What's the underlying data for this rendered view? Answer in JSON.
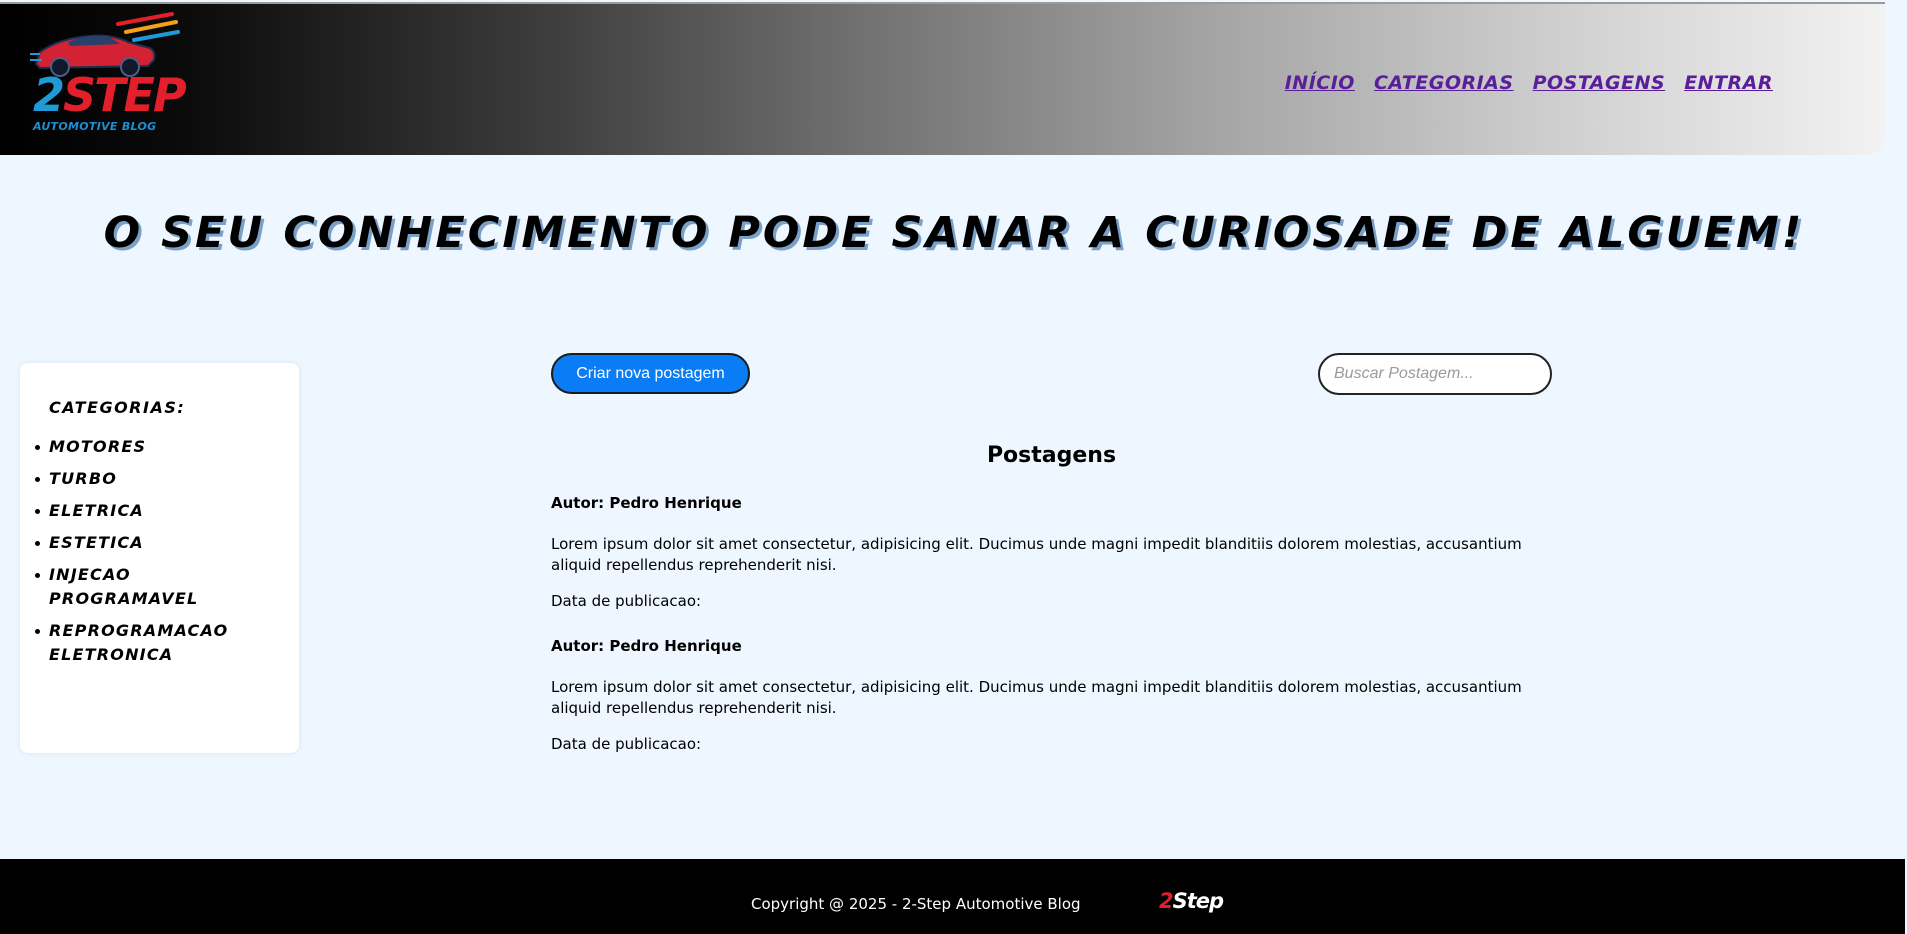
{
  "header": {
    "logo": {
      "number": "2",
      "word": "STEP",
      "subtitle": "AUTOMOTIVE BLOG"
    },
    "nav": [
      {
        "label": "INÍCIO"
      },
      {
        "label": "CATEGORIAS"
      },
      {
        "label": "POSTAGENS"
      },
      {
        "label": "ENTRAR"
      }
    ]
  },
  "hero": {
    "title": "O SEU CONHECIMENTO PODE SANAR A CURIOSADE DE ALGUEM!"
  },
  "sidebar": {
    "title": "CATEGORIAS:",
    "items": [
      {
        "label": "MOTORES"
      },
      {
        "label": "TURBO"
      },
      {
        "label": "ELETRICA"
      },
      {
        "label": "ESTETICA"
      },
      {
        "label": "INJECAO PROGRAMAVEL"
      },
      {
        "label": "REPROGRAMACAO ELETRONICA"
      }
    ]
  },
  "main": {
    "new_post_label": "Criar nova postagem",
    "search": {
      "placeholder": "Buscar Postagem...",
      "value": ""
    },
    "posts_title": "Postagens",
    "posts": [
      {
        "author": "Autor: Pedro Henrique",
        "body": "Lorem ipsum dolor sit amet consectetur, adipisicing elit. Ducimus unde magni impedit blanditiis dolorem molestias, accusantium aliquid repellendus reprehenderit nisi.",
        "date": "Data de publicacao:"
      },
      {
        "author": "Autor: Pedro Henrique",
        "body": "Lorem ipsum dolor sit amet consectetur, adipisicing elit. Ducimus unde magni impedit blanditiis dolorem molestias, accusantium aliquid repellendus reprehenderit nisi.",
        "date": "Data de publicacao:"
      }
    ]
  },
  "footer": {
    "copyright": "Copyright @ 2025 - 2-Step Automotive Blog",
    "mini_logo": {
      "number": "2",
      "word": "Step"
    }
  },
  "colors": {
    "nav_link": "#5b1e9a",
    "button_primary": "#0a7cf5",
    "page_background": "#eef6ff",
    "logo_blue": "#1e9ad6",
    "logo_red": "#e21f2b"
  }
}
